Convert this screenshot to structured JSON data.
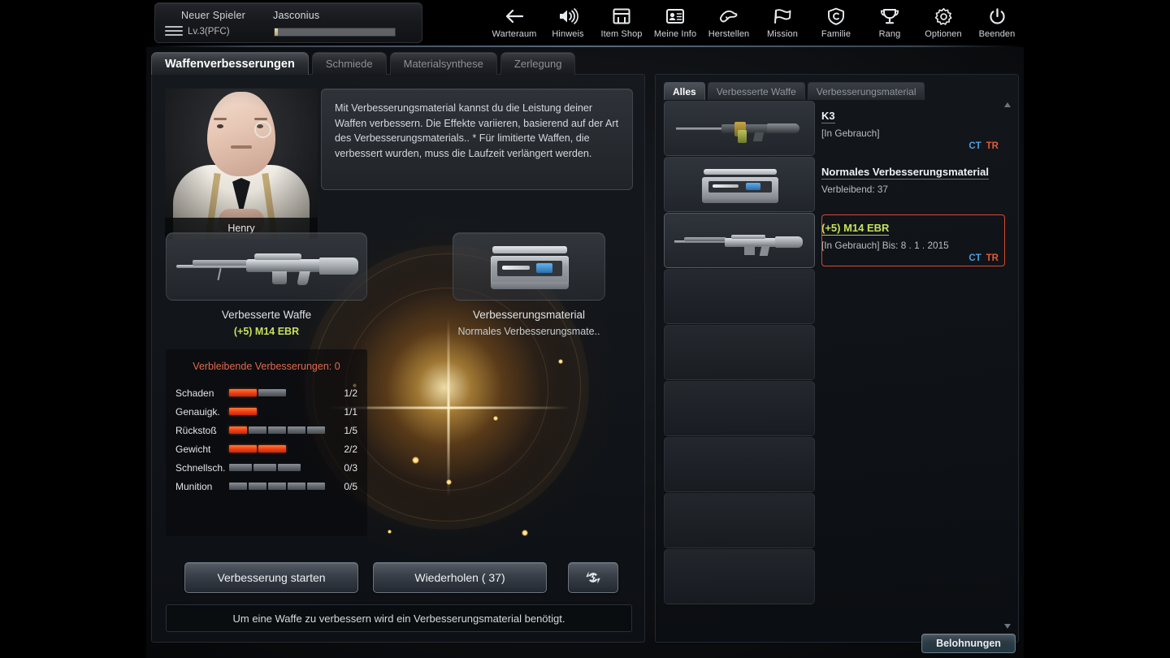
{
  "player": {
    "status_label": "Neuer Spieler",
    "level": "Lv.3(PFC)",
    "name": "Jasconius"
  },
  "nav": [
    {
      "label": "Warteraum",
      "icon": "arrow-left-icon"
    },
    {
      "label": "Hinweis",
      "icon": "speaker-icon"
    },
    {
      "label": "Item Shop",
      "icon": "shop-icon"
    },
    {
      "label": "Meine Info",
      "icon": "id-card-icon"
    },
    {
      "label": "Herstellen",
      "icon": "hammer-icon"
    },
    {
      "label": "Mission",
      "icon": "flag-icon"
    },
    {
      "label": "Familie",
      "icon": "clan-shield-icon"
    },
    {
      "label": "Rang",
      "icon": "trophy-icon"
    },
    {
      "label": "Optionen",
      "icon": "gear-icon"
    },
    {
      "label": "Beenden",
      "icon": "power-icon"
    }
  ],
  "tabs": [
    {
      "label": "Waffenverbesserungen",
      "active": true
    },
    {
      "label": "Schmiede",
      "active": false
    },
    {
      "label": "Materialsynthese",
      "active": false
    },
    {
      "label": "Zerlegung",
      "active": false
    }
  ],
  "npc": {
    "name": "Henry",
    "dialog": "Mit Verbesserungsmaterial kannst du die Leistung deiner Waffen verbessern. Die Effekte variieren, basierend auf der Art des Verbesserungsmaterials.. * Für limitierte Waffen, die verbessert wurden, muss die Laufzeit verlängert werden."
  },
  "slots": {
    "weapon": {
      "caption": "Verbesserte Waffe",
      "item_name": "(+5) M14 EBR"
    },
    "material": {
      "caption": "Verbesserungsmaterial",
      "item_name": "Normales Verbesserungsmate.."
    }
  },
  "stats": {
    "title": "Verbleibende Verbesserungen: 0",
    "rows": [
      {
        "label": "Schaden",
        "filled": 1,
        "total": 2,
        "value": "1/2"
      },
      {
        "label": "Genauigk.",
        "filled": 1,
        "total": 1,
        "value": "1/1"
      },
      {
        "label": "Rückstoß",
        "filled": 1,
        "total": 5,
        "value": "1/5"
      },
      {
        "label": "Gewicht",
        "filled": 2,
        "total": 2,
        "value": "2/2"
      },
      {
        "label": "Schnellsch.",
        "filled": 0,
        "total": 3,
        "value": "0/3"
      },
      {
        "label": "Munition",
        "filled": 0,
        "total": 5,
        "value": "0/5"
      }
    ]
  },
  "actions": {
    "start": "Verbesserung starten",
    "repeat": "Wiederholen ( 37)",
    "refresh_icon": "refresh-icon",
    "hint": "Um eine Waffe zu verbessern wird ein Verbesserungsmaterial benötigt."
  },
  "inventory": {
    "tabs": [
      {
        "label": "Alles",
        "active": true
      },
      {
        "label": "Verbesserte Waffe",
        "active": false
      },
      {
        "label": "Verbesserungsmaterial",
        "active": false
      }
    ],
    "items": [
      {
        "name": "K3",
        "name_color": "white",
        "sub": "[In Gebrauch]",
        "ct": "CT",
        "tr": "TR",
        "thumb": "lmg",
        "selected": false
      },
      {
        "name": "Normales Verbesserungsmaterial",
        "name_color": "white",
        "sub": "Verbleibend: 37",
        "ct": "",
        "tr": "",
        "thumb": "matbox",
        "selected": false
      },
      {
        "name": "(+5) M14 EBR",
        "name_color": "green",
        "sub": "[In Gebrauch] Bis: 8 . 1 . 2015",
        "ct": "CT",
        "tr": "TR",
        "thumb": "rifle",
        "selected": true
      }
    ],
    "empty_slot_count": 6
  },
  "rewards_button": "Belohnungen",
  "colors": {
    "accent_green": "#c9e05b",
    "accent_red": "#e06b4a",
    "ct_blue": "#4d9ee0",
    "tr_red": "#e05a3d",
    "stat_filled": "#f03d16",
    "stat_empty": "#5e636a"
  }
}
